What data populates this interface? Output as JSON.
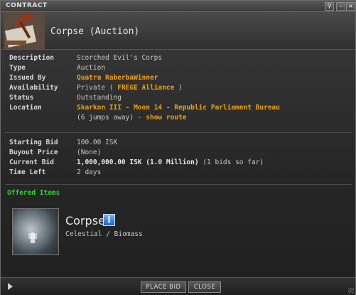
{
  "window": {
    "title": "CONTRACT"
  },
  "header": {
    "title": "Corpse (Auction)"
  },
  "details": {
    "description": {
      "label": "Description",
      "value": "Scorched Evil's Corps"
    },
    "type": {
      "label": "Type",
      "value": "Auction"
    },
    "issued_by": {
      "label": "Issued By",
      "value": "Quatra RaberbaWinner"
    },
    "availability": {
      "label": "Availability",
      "prefix": "Private (",
      "link": "FREGE Alliance",
      "suffix": ")"
    },
    "status": {
      "label": "Status",
      "value": "Outstanding"
    },
    "location": {
      "label": "Location",
      "value": "Skarkon III - Moon 14 - Republic Parliament Bureau",
      "jumps": "(6 jumps away) -",
      "route_link": "show route"
    }
  },
  "bidding": {
    "starting_bid": {
      "label": "Starting Bid",
      "value": "100.00 ISK"
    },
    "buyout_price": {
      "label": "Buyout Price",
      "value": "(None)"
    },
    "current_bid": {
      "label": "Current Bid",
      "value": "1,000,000.00 ISK (1.0 Million)",
      "note": "(1 bids so far)"
    },
    "time_left": {
      "label": "Time Left",
      "value": "2 days"
    }
  },
  "offered": {
    "section_title": "Offered Items",
    "item_name": "Corpse",
    "item_category": "Celestial / Biomass",
    "info_icon": "info-icon"
  },
  "footer": {
    "place_bid": "PLACE BID",
    "close": "CLOSE"
  },
  "colors": {
    "link": "#f0a010",
    "section": "#2ed02e",
    "info": "#1b62c9"
  }
}
